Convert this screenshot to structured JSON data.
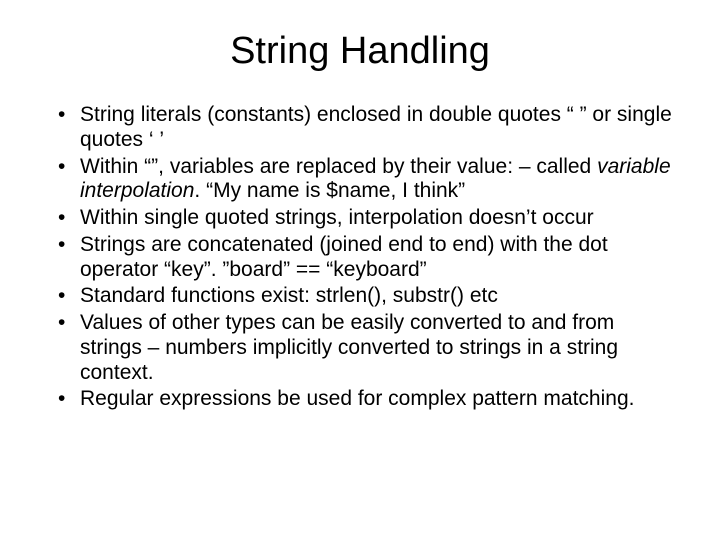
{
  "title": "String Handling",
  "bullets": [
    {
      "text": "String literals (constants) enclosed in double quotes “ ” or single quotes ‘ ’"
    },
    {
      "pre": "Within “”, variables are replaced by their value: – called ",
      "em": "variable interpolation",
      "post": ". “My name is $name, I think”"
    },
    {
      "text": "Within single quoted strings, interpolation doesn’t occur"
    },
    {
      "text": "Strings are concatenated (joined end to end) with the dot operator  “key”. ”board” == “keyboard”"
    },
    {
      "text": "Standard functions exist: strlen(), substr() etc"
    },
    {
      "text": "Values of other types can be easily converted to and from strings – numbers implicitly converted to strings in a string context."
    },
    {
      "text": "Regular expressions be used for complex pattern matching."
    }
  ]
}
